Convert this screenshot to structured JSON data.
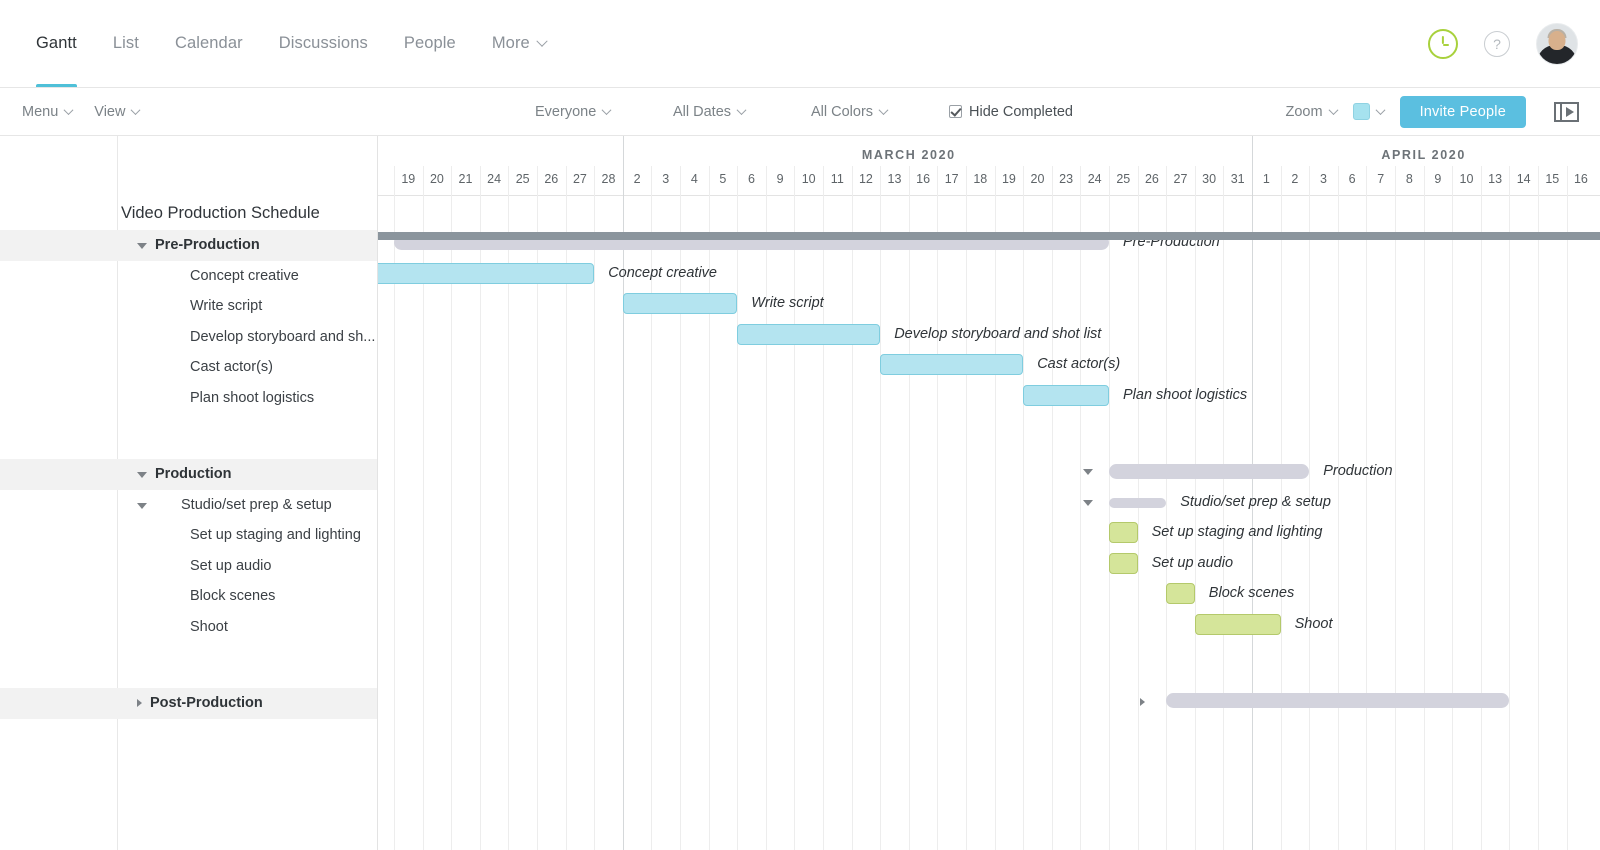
{
  "theme": {
    "accent_teal": "#4fc0d8",
    "accent_blue": "#5bbfe0",
    "task_blue_fill": "#b4e4f0",
    "task_blue_border": "#7fcddf",
    "task_green_fill": "#d5e59a",
    "task_green_border": "#b4c96b",
    "summary_gray": "#d3d3dd",
    "scrollbar_gray": "#8b959d",
    "timer_green": "#a8d13c"
  },
  "topnav": {
    "tabs": [
      {
        "label": "Gantt",
        "active": true
      },
      {
        "label": "List",
        "active": false
      },
      {
        "label": "Calendar",
        "active": false
      },
      {
        "label": "Discussions",
        "active": false
      },
      {
        "label": "People",
        "active": false
      },
      {
        "label": "More",
        "active": false,
        "has_caret": true
      }
    ],
    "icons": {
      "timer": "timer-clock-icon",
      "help": "?",
      "avatar": "user-avatar"
    }
  },
  "toolbar": {
    "menu_label": "Menu",
    "view_label": "View",
    "everyone_label": "Everyone",
    "all_dates_label": "All Dates",
    "all_colors_label": "All Colors",
    "hide_completed_label": "Hide Completed",
    "hide_completed_checked": true,
    "zoom_label": "Zoom",
    "invite_label": "Invite People",
    "video_icon": "video-player-icon"
  },
  "project": {
    "title": "Video Production Schedule"
  },
  "timeline": {
    "months": [
      {
        "label": "MARCH 2020",
        "start_index": 8,
        "end_index": 27
      },
      {
        "label": "APRIL 2020",
        "start_index": 28,
        "end_index": 43
      }
    ],
    "days": [
      "19",
      "20",
      "21",
      "24",
      "25",
      "26",
      "27",
      "28",
      "2",
      "3",
      "4",
      "5",
      "6",
      "9",
      "10",
      "11",
      "12",
      "13",
      "16",
      "17",
      "18",
      "19",
      "20",
      "23",
      "24",
      "25",
      "26",
      "27",
      "30",
      "31",
      "1",
      "2",
      "3",
      "6",
      "7",
      "8",
      "9",
      "10",
      "13",
      "14",
      "15",
      "16"
    ],
    "month_boundaries": [
      8,
      30
    ]
  },
  "tasks": [
    {
      "name": "Pre-Production",
      "level": 1,
      "type": "section",
      "expanded": true,
      "bar": {
        "color": "summary",
        "start": 0,
        "span": 25,
        "label": "Pre-Production"
      }
    },
    {
      "name": "Concept creative",
      "level": 2,
      "type": "task",
      "bar": {
        "color": "blue",
        "start": -1,
        "span": 8,
        "label": "Concept creative"
      }
    },
    {
      "name": "Write script",
      "level": 2,
      "type": "task",
      "bar": {
        "color": "blue",
        "start": 8,
        "span": 4,
        "label": "Write script"
      }
    },
    {
      "name": "Develop storyboard and sh...",
      "full_name": "Develop storyboard and shot list",
      "level": 2,
      "type": "task",
      "bar": {
        "color": "blue",
        "start": 12,
        "span": 5,
        "label": "Develop storyboard and shot list"
      }
    },
    {
      "name": "Cast actor(s)",
      "level": 2,
      "type": "task",
      "bar": {
        "color": "blue",
        "start": 17,
        "span": 5,
        "label": "Cast actor(s)"
      }
    },
    {
      "name": "Plan shoot logistics",
      "level": 2,
      "type": "task",
      "bar": {
        "color": "blue",
        "start": 22,
        "span": 3,
        "label": "Plan shoot logistics"
      }
    },
    {
      "name": "Production",
      "level": 1,
      "type": "section",
      "expanded": true,
      "bar": {
        "color": "summary",
        "start": 25,
        "span": 7,
        "label": "Production"
      }
    },
    {
      "name": "Studio/set prep & setup",
      "level": 2,
      "type": "subsection",
      "expanded": true,
      "bar": {
        "color": "summary-thin",
        "start": 25,
        "span": 2,
        "label": "Studio/set prep & setup"
      }
    },
    {
      "name": "Set up staging and lighting",
      "level": 3,
      "type": "task",
      "bar": {
        "color": "green",
        "start": 25,
        "span": 1,
        "label": "Set up staging and lighting"
      }
    },
    {
      "name": "Set up audio",
      "level": 3,
      "type": "task",
      "bar": {
        "color": "green",
        "start": 25,
        "span": 1,
        "label": "Set up audio"
      }
    },
    {
      "name": "Block scenes",
      "level": 2,
      "type": "task",
      "bar": {
        "color": "green",
        "start": 27,
        "span": 1,
        "label": "Block scenes"
      }
    },
    {
      "name": "Shoot",
      "level": 2,
      "type": "task",
      "bar": {
        "color": "green",
        "start": 28,
        "span": 3,
        "label": "Shoot"
      }
    },
    {
      "name": "Post-Production",
      "level": 1,
      "type": "section",
      "expanded": false,
      "bar": {
        "color": "summary",
        "start": 27,
        "span": 12,
        "label": ""
      }
    }
  ]
}
